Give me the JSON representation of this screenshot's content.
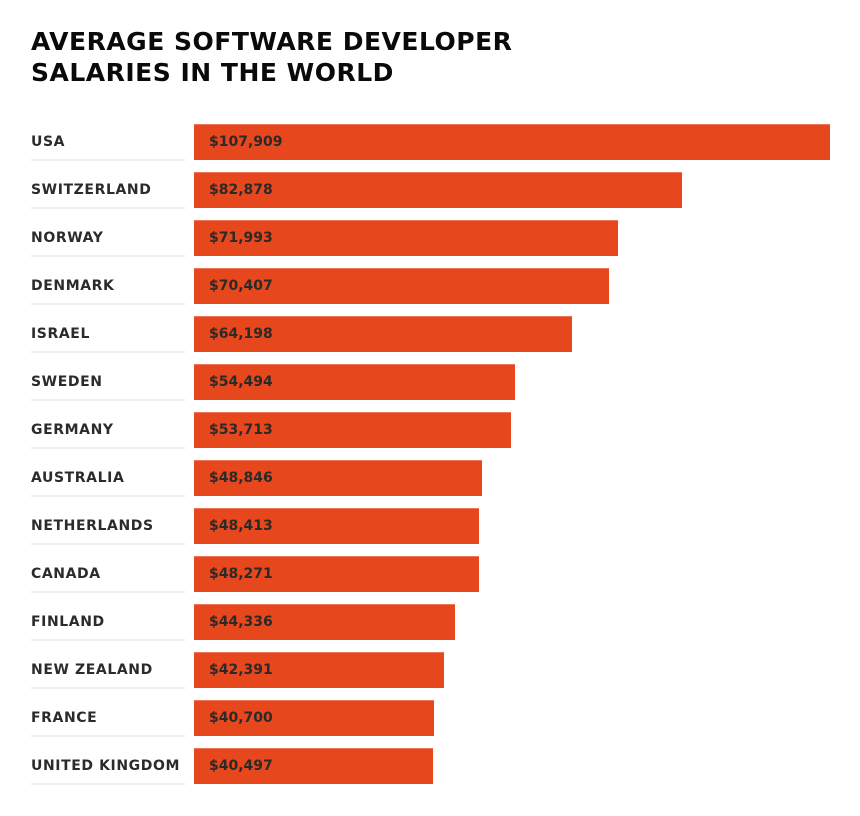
{
  "chart_data": {
    "type": "bar",
    "orientation": "horizontal",
    "title": "AVERAGE SOFTWARE DEVELOPER SALARIES IN THE WORLD",
    "title_lines": [
      "AVERAGE SOFTWARE DEVELOPER",
      "SALARIES IN THE WORLD"
    ],
    "xlabel": "",
    "ylabel": "",
    "unit": "USD",
    "grid": false,
    "legend": "none",
    "bar_color": "#e6471c",
    "categories": [
      "USA",
      "SWITZERLAND",
      "NORWAY",
      "DENMARK",
      "ISRAEL",
      "SWEDEN",
      "GERMANY",
      "AUSTRALIA",
      "NETHERLANDS",
      "CANADA",
      "FINLAND",
      "NEW ZEALAND",
      "FRANCE",
      "UNITED KINGDOM"
    ],
    "values": [
      107909,
      82878,
      71993,
      70407,
      64198,
      54494,
      53713,
      48846,
      48413,
      48271,
      44336,
      42391,
      40700,
      40497
    ],
    "value_labels": [
      "$107,909",
      "$82,878",
      "$71,993",
      "$70,407",
      "$64,198",
      "$54,494",
      "$53,713",
      "$48,846",
      "$48,413",
      "$48,271",
      "$44,336",
      "$42,391",
      "$40,700",
      "$40,497"
    ],
    "xlim": [
      0,
      107909
    ]
  }
}
